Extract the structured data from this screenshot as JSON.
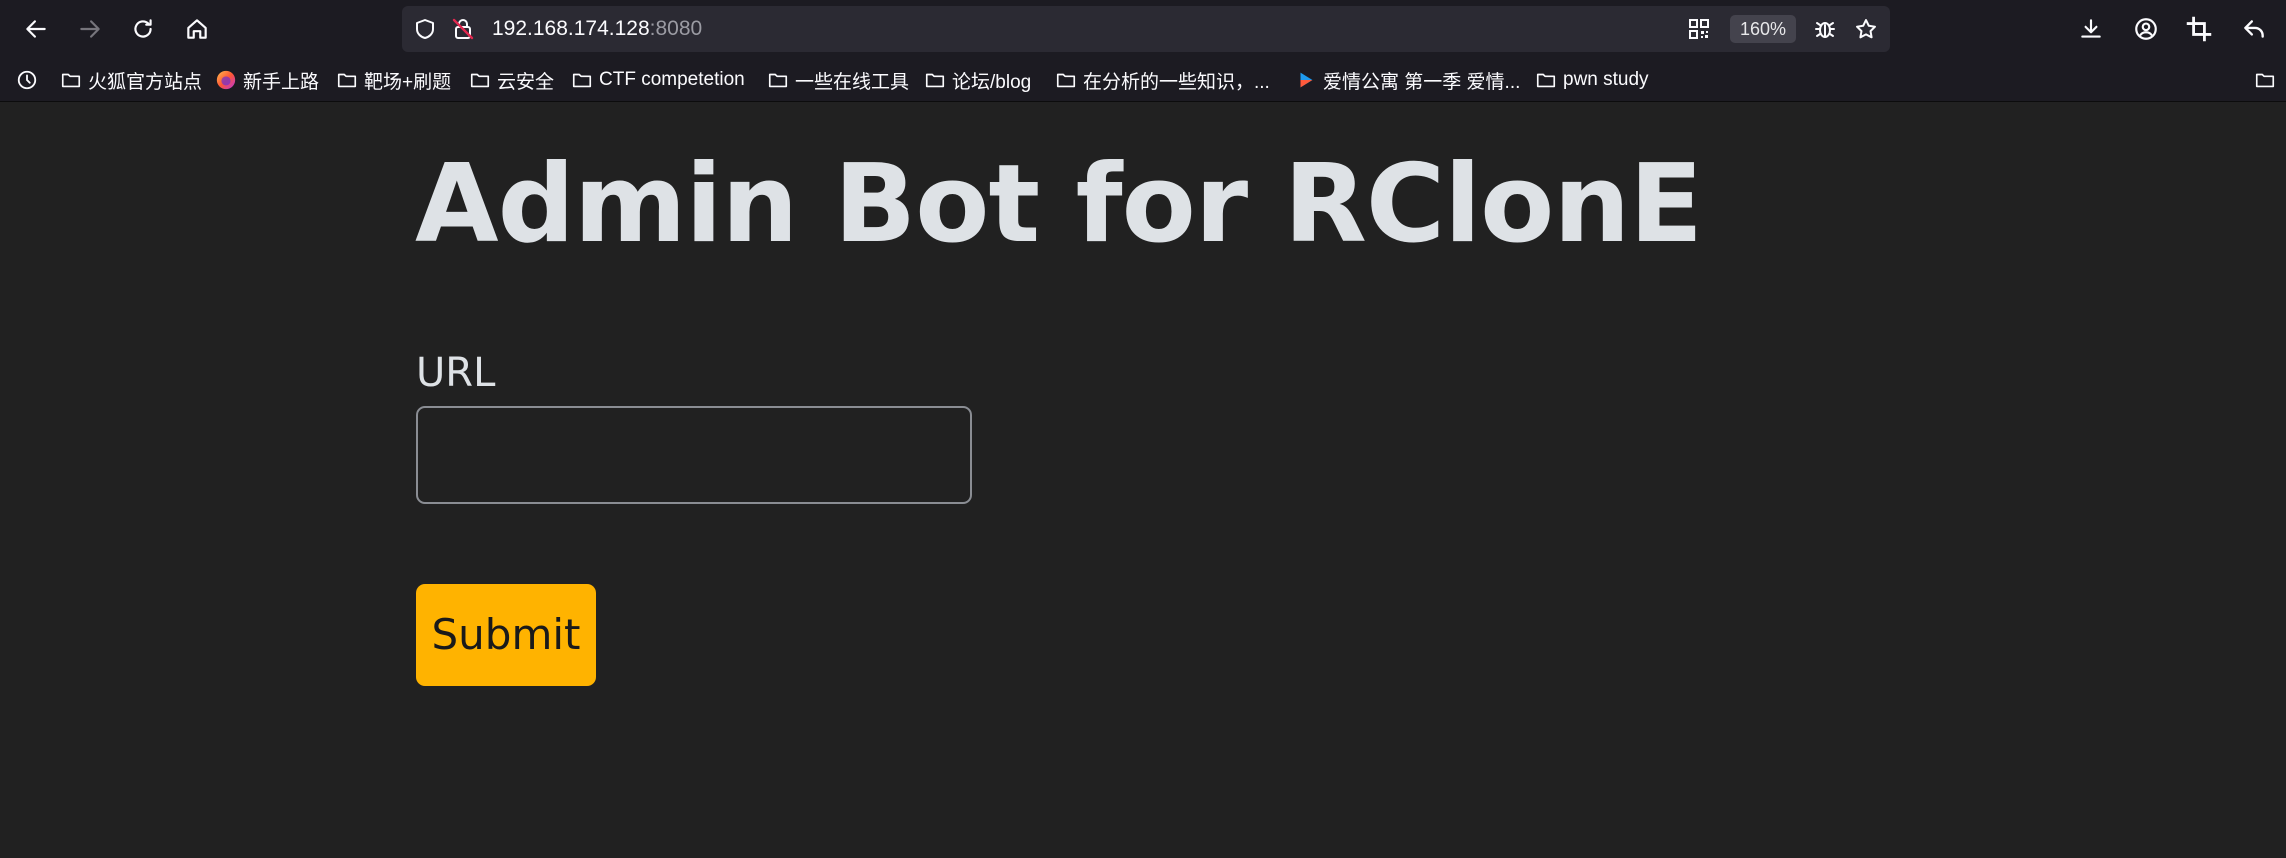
{
  "browser": {
    "address": {
      "host": "192.168.174.128",
      "port": ":8080"
    },
    "zoom": "160%",
    "nav_icons": [
      "back-icon",
      "forward-icon",
      "reload-icon",
      "home-icon"
    ],
    "toolbar_icons": [
      "qr-code-icon",
      "bug-icon",
      "star-icon",
      "download-icon",
      "account-icon",
      "crop-icon",
      "share-icon"
    ],
    "bookmarks": [
      {
        "label": "火狐官方站点",
        "icon": "folder-icon"
      },
      {
        "label": "新手上路",
        "icon": "firefox-icon"
      },
      {
        "label": "靶场+刷题",
        "icon": "folder-icon"
      },
      {
        "label": "云安全",
        "icon": "folder-icon"
      },
      {
        "label": "CTF competetion",
        "icon": "folder-icon"
      },
      {
        "label": "一些在线工具",
        "icon": "folder-icon"
      },
      {
        "label": "论坛/blog",
        "icon": "folder-icon"
      },
      {
        "label": "在分析的一些知识，...",
        "icon": "folder-icon"
      },
      {
        "label": "爱情公寓 第一季 爱情...",
        "icon": "video-icon"
      },
      {
        "label": "pwn study",
        "icon": "folder-icon"
      }
    ]
  },
  "page": {
    "title": "Admin Bot for RClonE",
    "form": {
      "url_label": "URL",
      "url_value": "",
      "submit_label": "Submit"
    }
  },
  "colors": {
    "background": "#212121",
    "text": "#dee2e6",
    "submit_button": "#ffb300",
    "browser_chrome": "#1c1b22",
    "urlbar": "#2b2a33"
  }
}
